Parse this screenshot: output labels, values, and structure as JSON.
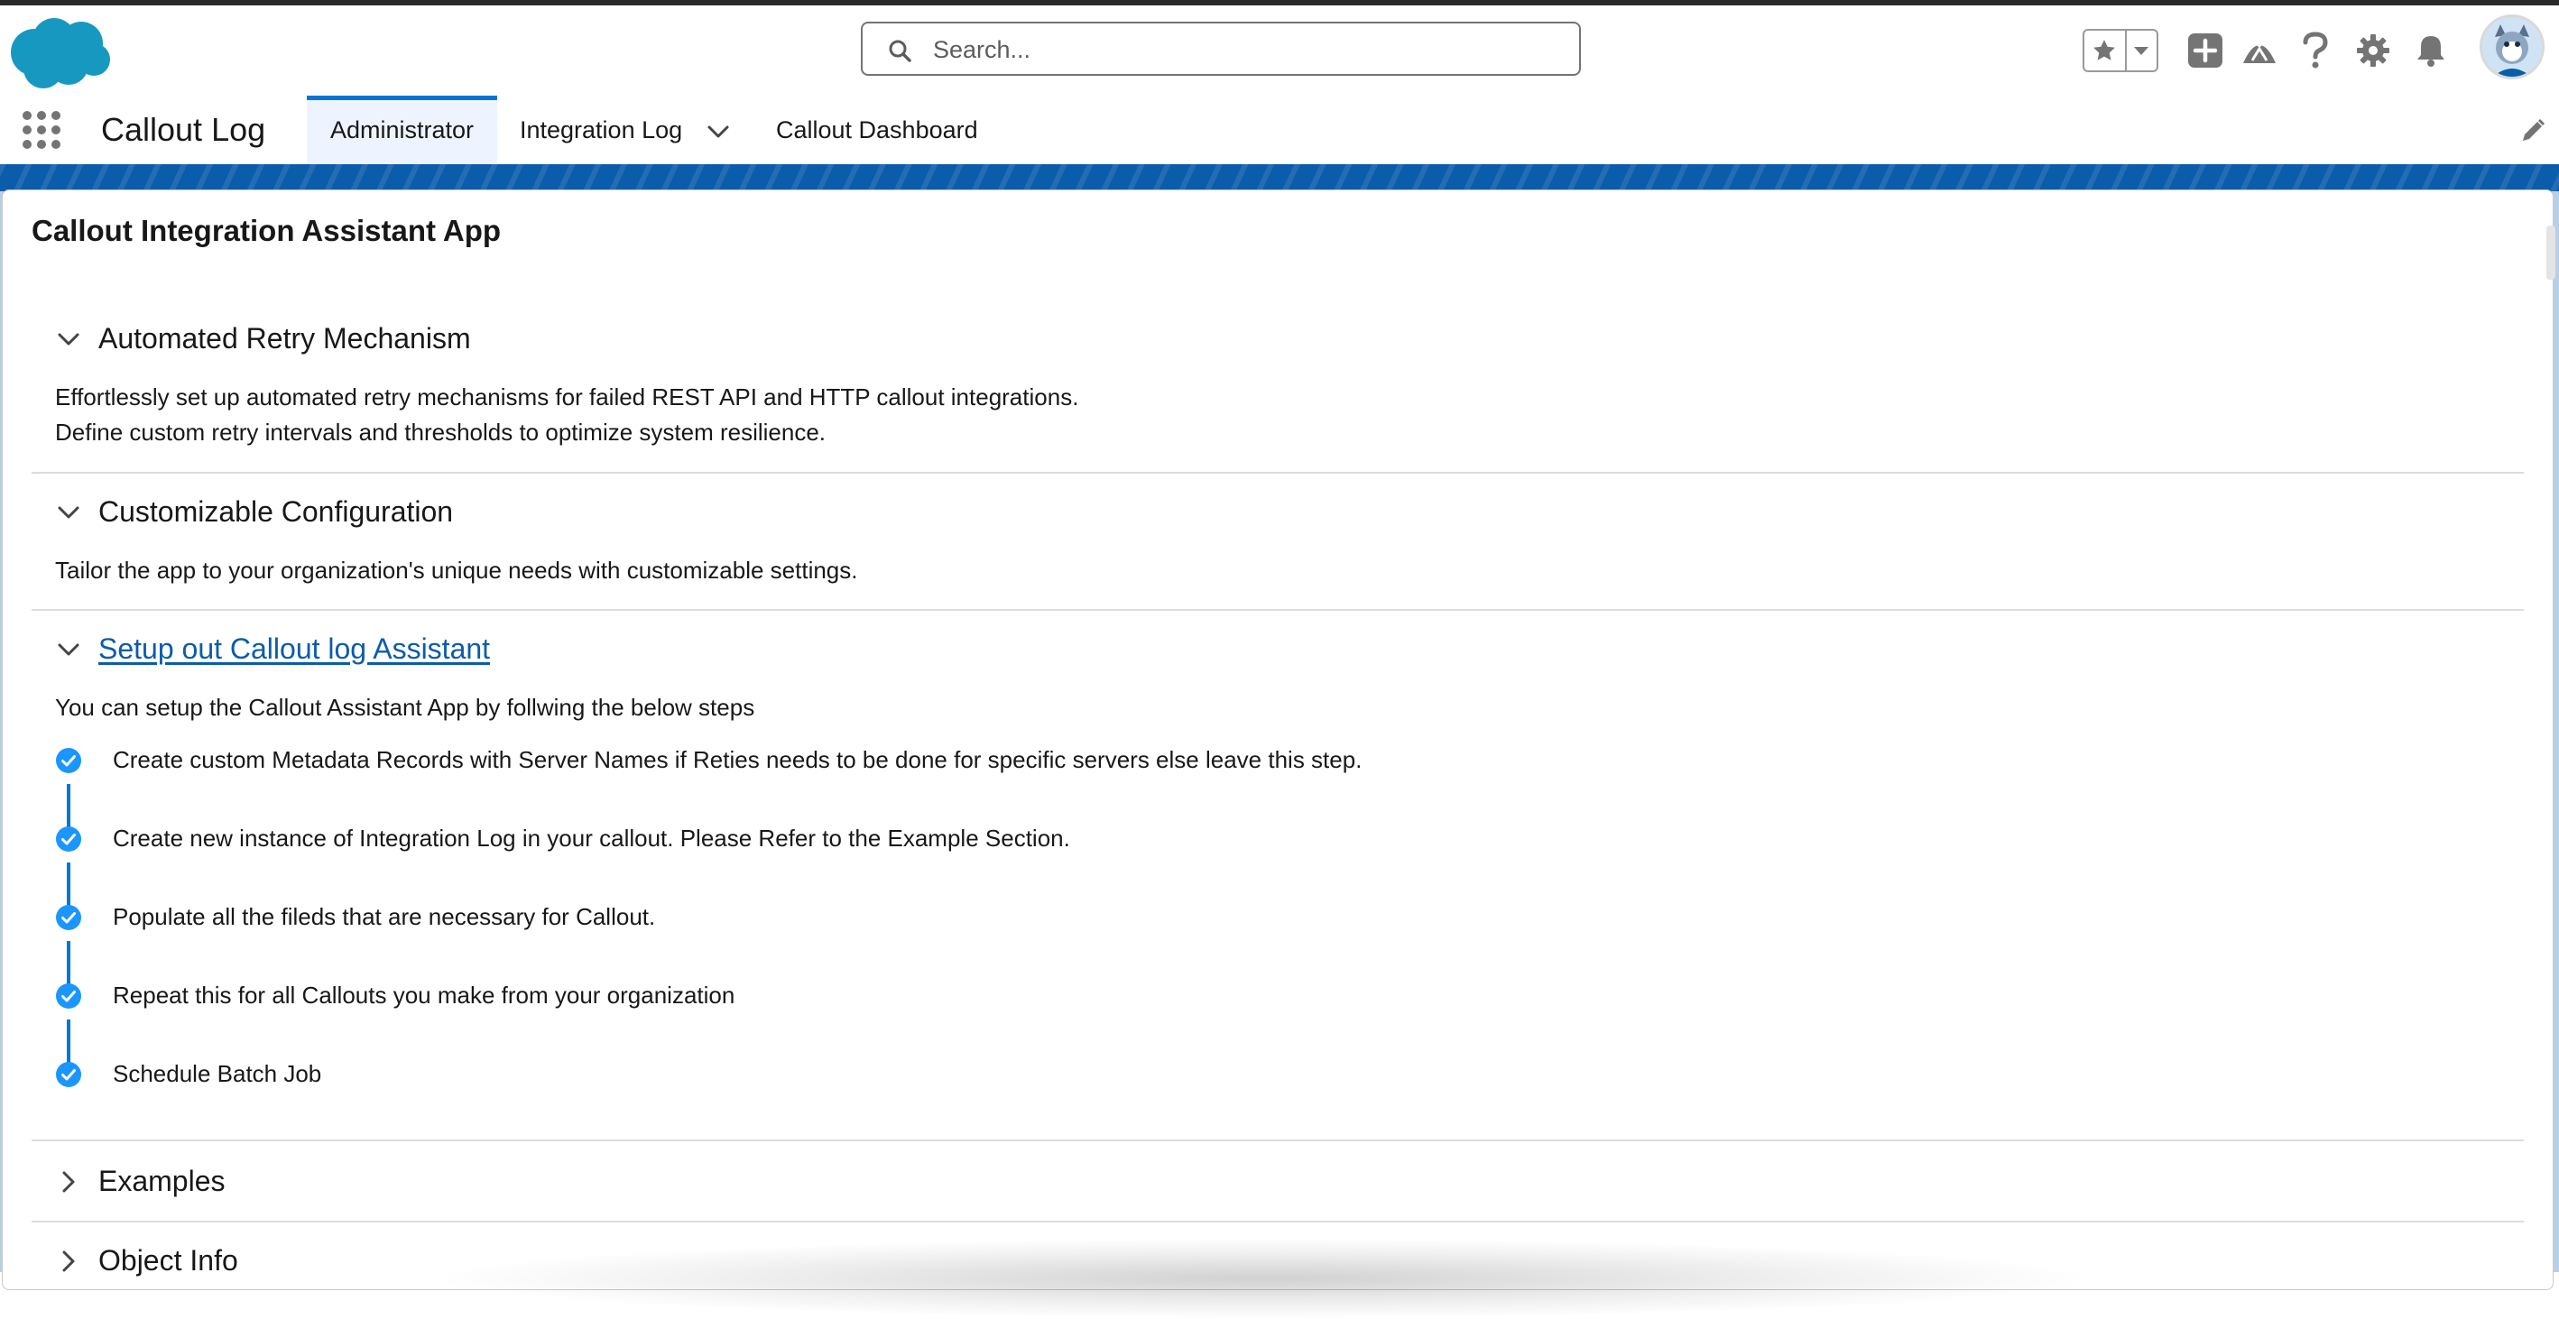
{
  "colors": {
    "brand_blue": "#0b5cab",
    "accent_blue": "#0176d3",
    "step_check": "#1b96ff",
    "icon_gray": "#747474",
    "text": "#181818"
  },
  "header": {
    "search_placeholder": "Search...",
    "icons": [
      "salesforce-logo",
      "favorites-star-icon",
      "favorites-dropdown-icon",
      "add-icon",
      "trailhead-icon",
      "help-icon",
      "setup-gear-icon",
      "notifications-bell-icon",
      "avatar"
    ]
  },
  "nav": {
    "app_name": "Callout Log",
    "tabs": [
      {
        "label": "Administrator",
        "active": true
      },
      {
        "label": "Integration Log",
        "has_dropdown": true
      },
      {
        "label": "Callout Dashboard"
      }
    ]
  },
  "page": {
    "title": "Callout Integration Assistant App",
    "sections": [
      {
        "title": "Automated Retry Mechanism",
        "expanded": true,
        "lines": [
          "Effortlessly set up automated retry mechanisms for failed REST API and HTTP callout integrations.",
          "Define custom retry intervals and thresholds to optimize system resilience."
        ]
      },
      {
        "title": "Customizable Configuration",
        "expanded": true,
        "lines": [
          "Tailor the app to your organization's unique needs with customizable settings."
        ]
      },
      {
        "title": "Setup out Callout log Assistant",
        "expanded": true,
        "is_link": true,
        "intro": "You can setup the Callout Assistant App by follwing the below steps",
        "steps": [
          "Create custom Metadata Records with Server Names if Reties needs to be done for specific servers else leave this step.",
          "Create new instance of Integration Log in your callout. Please Refer to the Example Section.",
          "Populate all the fileds that are necessary for Callout.",
          "Repeat this for all Callouts you make from your organization",
          "Schedule Batch Job"
        ]
      },
      {
        "title": "Examples",
        "expanded": false
      },
      {
        "title": "Object Info",
        "expanded": false
      }
    ]
  }
}
